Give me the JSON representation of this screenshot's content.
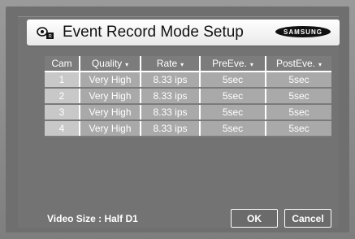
{
  "header": {
    "title": "Event Record Mode Setup",
    "brand": "SAMSUNG",
    "icon": "camera-record-icon"
  },
  "table": {
    "columns": [
      "Cam",
      "Quality",
      "Rate",
      "PreEve.",
      "PostEve."
    ],
    "dropdown_caret": "▾",
    "rows": [
      {
        "cam": "1",
        "quality": "Very High",
        "rate": "8.33 ips",
        "pre": "5sec",
        "post": "5sec"
      },
      {
        "cam": "2",
        "quality": "Very High",
        "rate": "8.33 ips",
        "pre": "5sec",
        "post": "5sec"
      },
      {
        "cam": "3",
        "quality": "Very High",
        "rate": "8.33 ips",
        "pre": "5sec",
        "post": "5sec"
      },
      {
        "cam": "4",
        "quality": "Very High",
        "rate": "8.33 ips",
        "pre": "5sec",
        "post": "5sec"
      }
    ]
  },
  "footer": {
    "video_size": "Video Size : Half D1",
    "ok_label": "OK",
    "cancel_label": "Cancel"
  },
  "colors": {
    "background": "#7a7a7a",
    "header_cell": "#7c7c7c",
    "data_cell": "#a9a9a9",
    "cam_cell": "#c8c8c8",
    "text": "#ffffff"
  }
}
